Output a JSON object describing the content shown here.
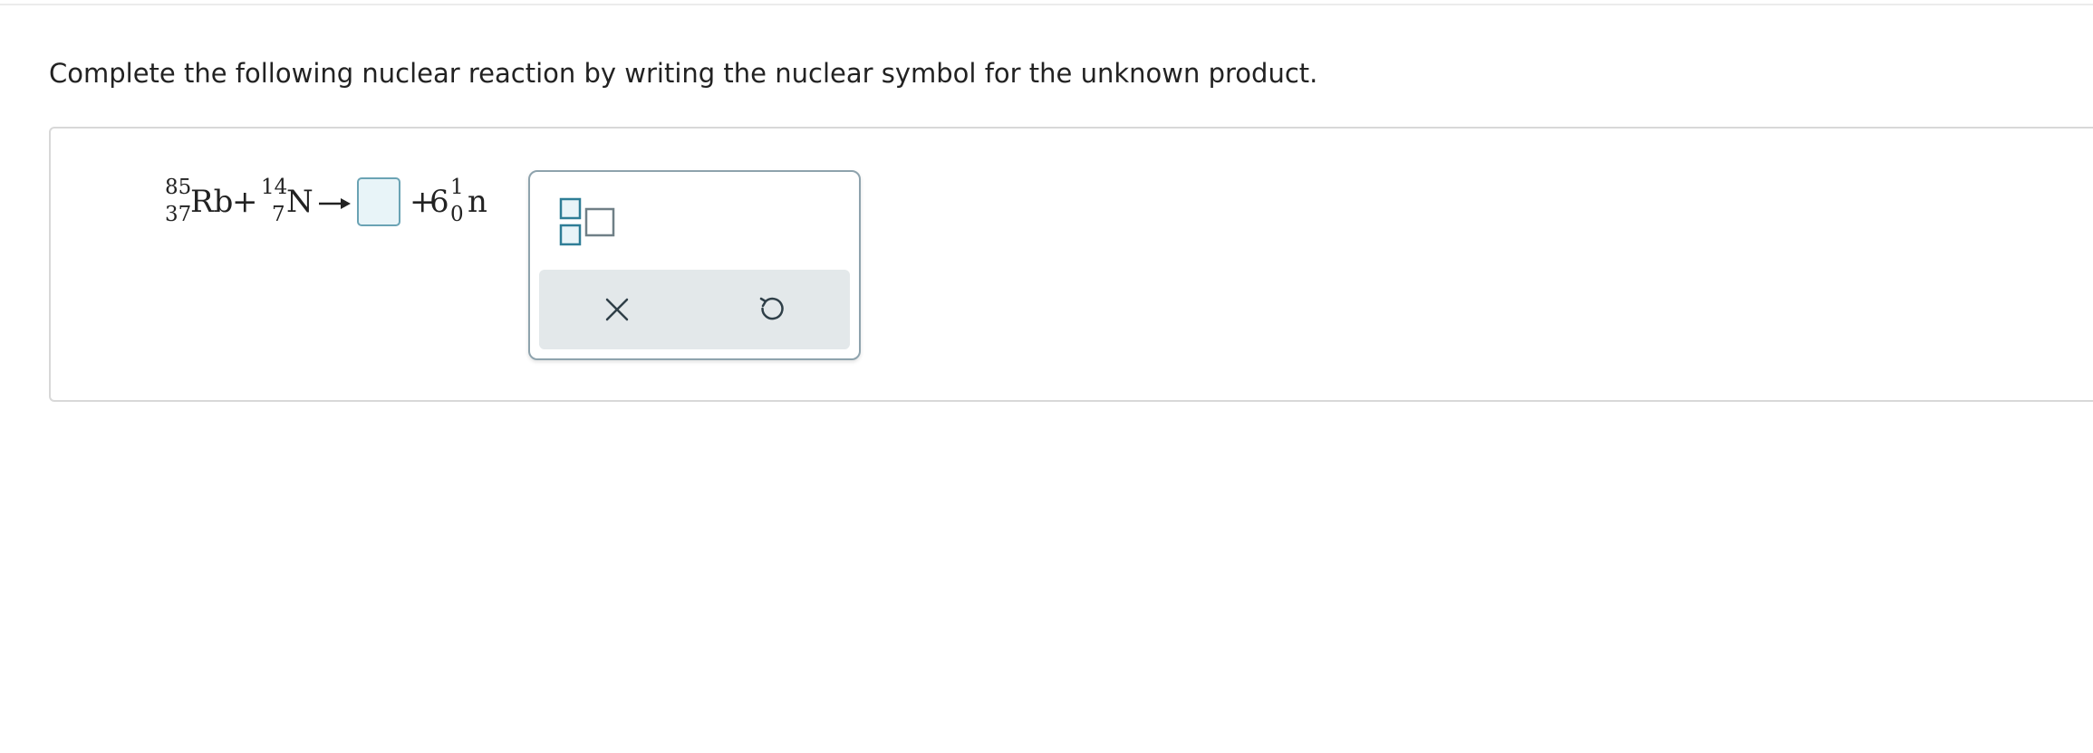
{
  "question": {
    "prompt": "Complete the following nuclear reaction by writing the nuclear symbol for the unknown product."
  },
  "equation": {
    "reactant1": {
      "mass": "85",
      "atomic": "37",
      "symbol": "Rb"
    },
    "plus1": "+",
    "reactant2": {
      "mass": "14",
      "atomic": "7",
      "symbol": "N"
    },
    "plus2": "+",
    "coefficient": "6",
    "product2": {
      "mass": "1",
      "atomic": "0",
      "symbol": "n"
    }
  },
  "palette": {
    "template_icon": "superscript-subscript-template-icon",
    "clear_icon": "close-icon",
    "undo_icon": "undo-icon"
  },
  "colors": {
    "accent": "#2e7d96",
    "slot_fill": "#e8f4f8",
    "slot_border": "#6aa3b4"
  }
}
